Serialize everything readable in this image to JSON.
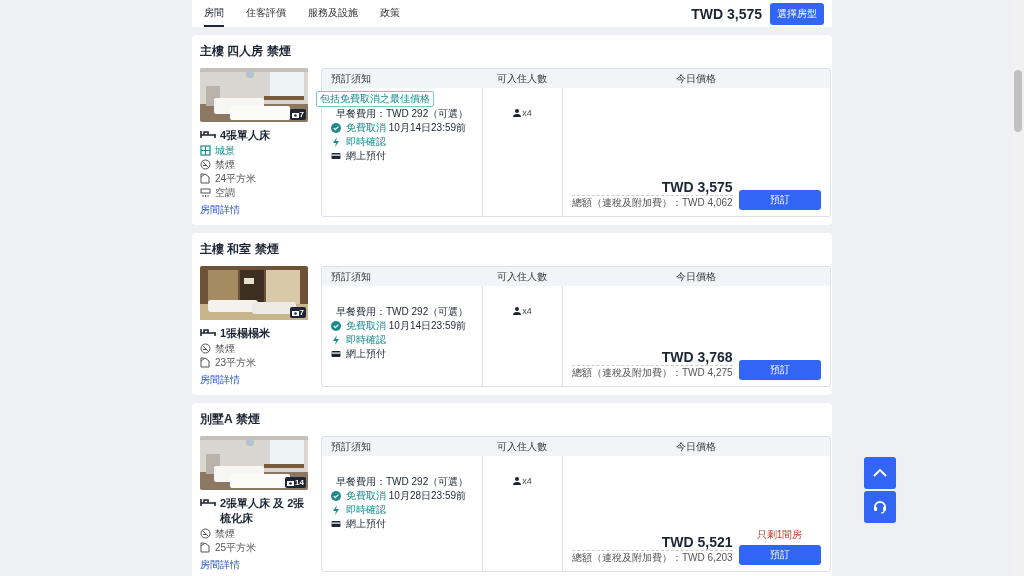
{
  "tabs": [
    {
      "label": "房間",
      "selected": true
    },
    {
      "label": "住客評價",
      "selected": false
    },
    {
      "label": "服務及設施",
      "selected": false
    },
    {
      "label": "政策",
      "selected": false
    }
  ],
  "header": {
    "price": "TWD 3,575",
    "button": "選擇房型"
  },
  "rooms": [
    {
      "title": "主樓 四人房 禁煙",
      "photo_count": "7",
      "features": [
        {
          "kind": "bed",
          "text": "4張單人床"
        },
        {
          "kind": "view",
          "text": "城景"
        },
        {
          "kind": "smoking",
          "text": "禁煙"
        },
        {
          "kind": "area",
          "text": "24平方米"
        },
        {
          "kind": "aircon",
          "text": "空調"
        }
      ],
      "details_link": "房間詳情",
      "columns": [
        "預訂須知",
        "可入住人數",
        "今日價格"
      ],
      "badge": "包括免費取消之最佳價格",
      "conditions": [
        {
          "kind": "breakfast",
          "text": "早餐費用：TWD 292（可選）"
        },
        {
          "kind": "cancel",
          "label": "免費取消",
          "text": "10月14日23:59前"
        },
        {
          "kind": "instant",
          "text": "即時確認"
        },
        {
          "kind": "prepay",
          "text": "網上預付"
        }
      ],
      "occupancy": "x4",
      "price": "TWD 3,575",
      "total": "總額（連稅及附加費）：TWD 4,062",
      "book_button": "預訂"
    },
    {
      "title": "主樓 和室 禁煙",
      "photo_count": "7",
      "features": [
        {
          "kind": "bed",
          "text": "1張榻榻米"
        },
        {
          "kind": "smoking",
          "text": "禁煙"
        },
        {
          "kind": "area",
          "text": "23平方米"
        }
      ],
      "details_link": "房間詳情",
      "columns": [
        "預訂須知",
        "可入住人數",
        "今日價格"
      ],
      "conditions": [
        {
          "kind": "breakfast",
          "text": "早餐費用：TWD 292（可選）"
        },
        {
          "kind": "cancel",
          "label": "免費取消",
          "text": "10月14日23:59前"
        },
        {
          "kind": "instant",
          "text": "即時確認"
        },
        {
          "kind": "prepay",
          "text": "網上預付"
        }
      ],
      "occupancy": "x4",
      "price": "TWD 3,768",
      "total": "總額（連稅及附加費）：TWD 4,275",
      "book_button": "預訂"
    },
    {
      "title": "別墅A 禁煙",
      "photo_count": "14",
      "features": [
        {
          "kind": "bed",
          "text": "2張單人床 及 2張梳化床"
        },
        {
          "kind": "smoking",
          "text": "禁煙"
        },
        {
          "kind": "area",
          "text": "25平方米"
        }
      ],
      "details_link": "房間詳情",
      "columns": [
        "預訂須知",
        "可入住人數",
        "今日價格"
      ],
      "conditions": [
        {
          "kind": "breakfast",
          "text": "早餐費用：TWD 292（可選）"
        },
        {
          "kind": "cancel",
          "label": "免費取消",
          "text": "10月28日23:59前"
        },
        {
          "kind": "instant",
          "text": "即時確認"
        },
        {
          "kind": "prepay",
          "text": "網上預付"
        }
      ],
      "occupancy": "x4",
      "scarcity": "只剩1間房",
      "price": "TWD 5,521",
      "total": "總額（連稅及附加費）：TWD 6,203",
      "book_button": "預訂"
    }
  ]
}
